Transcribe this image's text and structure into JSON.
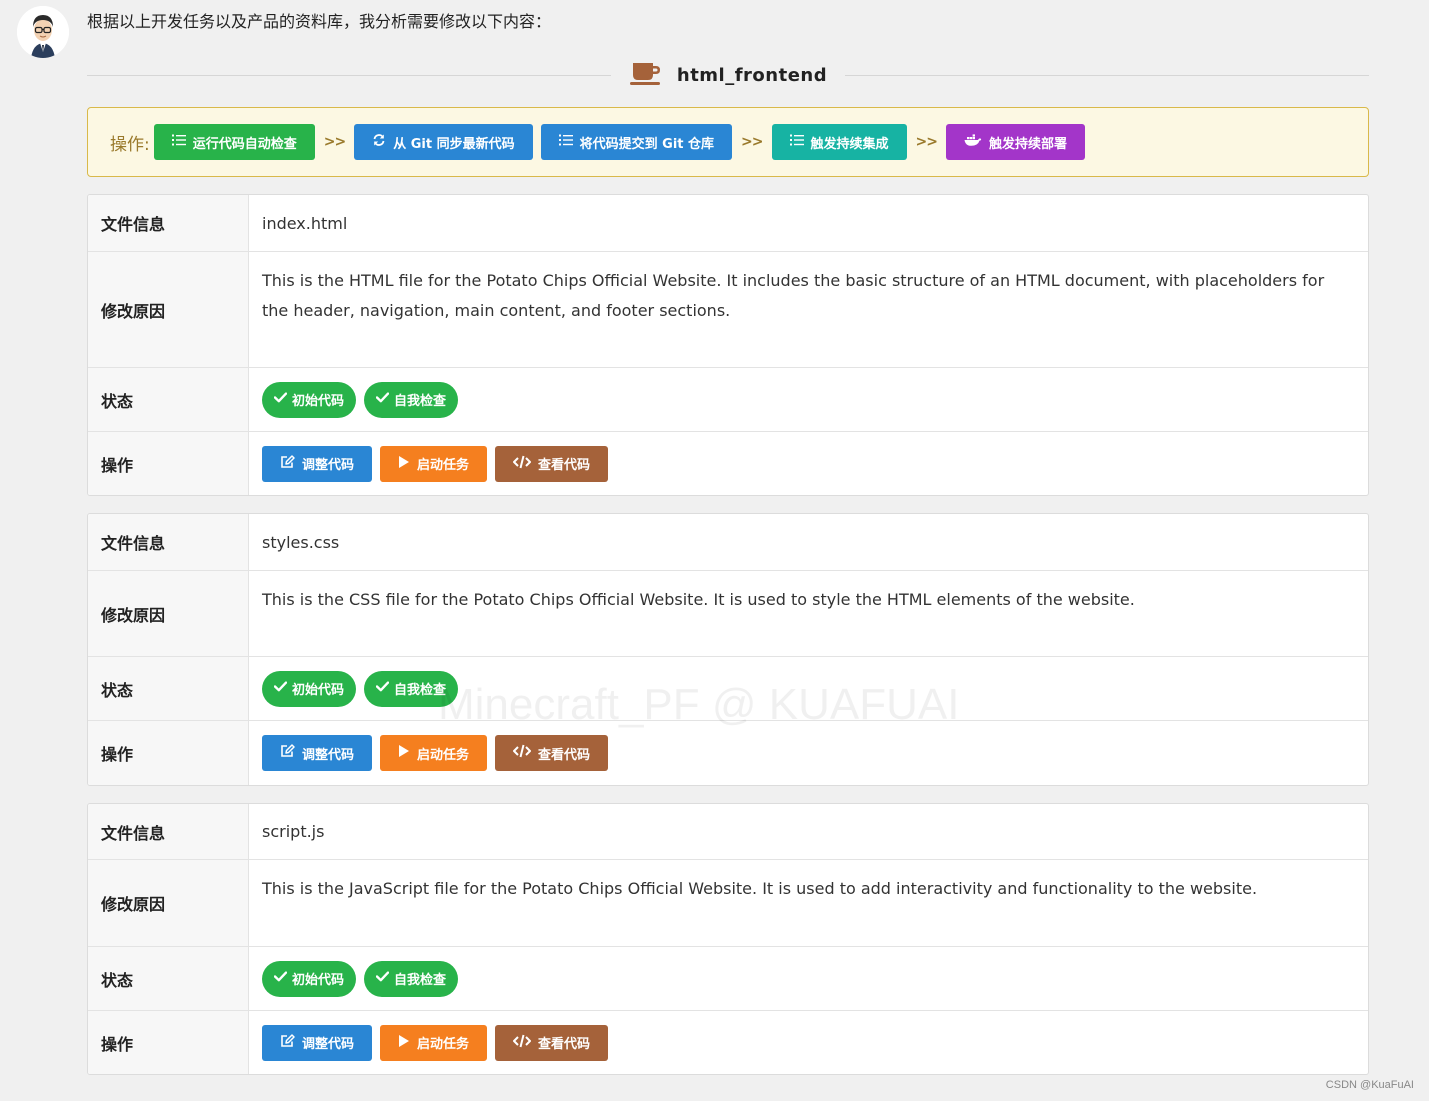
{
  "intro_text": "根据以上开发任务以及产品的资料库，我分析需要修改以下内容：",
  "section_title": "html_frontend",
  "colors": {
    "green": "#28b34a",
    "blue": "#2a86d4",
    "teal": "#17b3a3",
    "purple": "#a335c9",
    "orange": "#f57f1f",
    "brown": "#a5623a",
    "cup": "#a5623a"
  },
  "ops_bar": {
    "label": "操作:",
    "arrow": ">>",
    "buttons": [
      {
        "label": "运行代码自动检查",
        "icon": "list-check-icon"
      },
      {
        "label": "从 Git 同步最新代码",
        "icon": "sync-icon"
      },
      {
        "label": "将代码提交到 Git 仓库",
        "icon": "list-check-icon"
      },
      {
        "label": "触发持续集成",
        "icon": "list-check-icon"
      },
      {
        "label": "触发持续部署",
        "icon": "docker-icon"
      }
    ]
  },
  "labels": {
    "file_info": "文件信息",
    "reason": "修改原因",
    "status": "状态",
    "actions": "操作"
  },
  "files": [
    {
      "name": "index.html",
      "reason": "This is the HTML file for the Potato Chips Official Website. It includes the basic structure of an HTML document, with placeholders for the header, navigation, main content, and footer sections.",
      "statuses": [
        "初始代码",
        "自我检查"
      ],
      "actions": [
        "调整代码",
        "启动任务",
        "查看代码"
      ]
    },
    {
      "name": "styles.css",
      "reason": "This is the CSS file for the Potato Chips Official Website. It is used to style the HTML elements of the website.",
      "statuses": [
        "初始代码",
        "自我检查"
      ],
      "actions": [
        "调整代码",
        "启动任务",
        "查看代码"
      ]
    },
    {
      "name": "script.js",
      "reason": "This is the JavaScript file for the Potato Chips Official Website. It is used to add interactivity and functionality to the website.",
      "statuses": [
        "初始代码",
        "自我检查"
      ],
      "actions": [
        "调整代码",
        "启动任务",
        "查看代码"
      ]
    }
  ],
  "watermark": "Minecraft_PF @ KUAFUAI",
  "credit": "CSDN @KuaFuAI"
}
